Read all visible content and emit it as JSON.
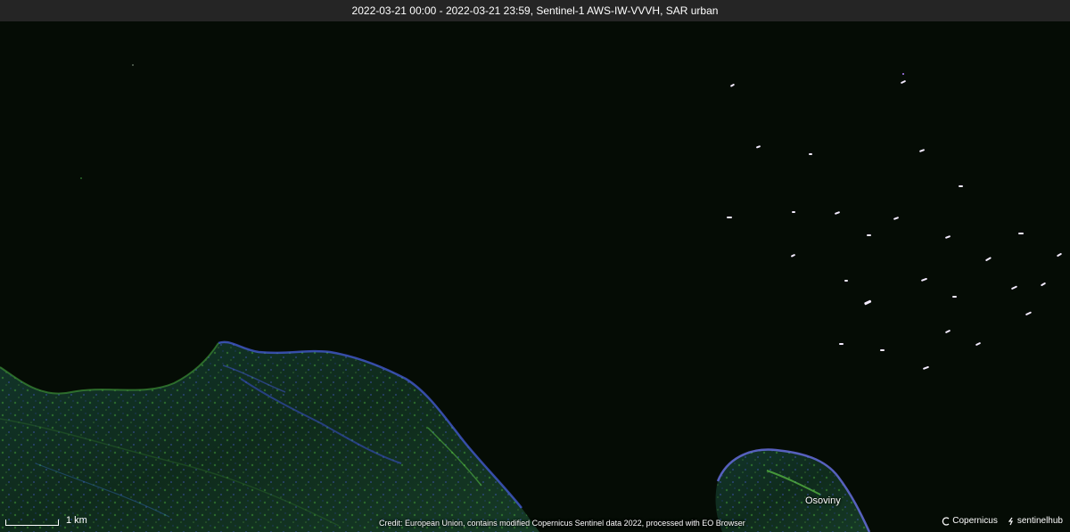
{
  "title_bar": {
    "text": "2022-03-21 00:00 - 2022-03-21 23:59, Sentinel-1 AWS-IW-VVVH, SAR urban"
  },
  "map": {
    "place_label": "Osoviny",
    "scale_label": "1 km",
    "credit": "Credit: European Union, contains modified Copernicus Sentinel data 2022, processed with EO Browser",
    "logos": {
      "copernicus": "Copernicus",
      "sentinelhub": "sentinelhub"
    },
    "colors": {
      "water": "#050c05",
      "land_dark": "#0e2a1a",
      "land_green": "#2d7a2f",
      "land_blue": "#3c4fd0",
      "ship_echo": "#f4ecff"
    }
  }
}
